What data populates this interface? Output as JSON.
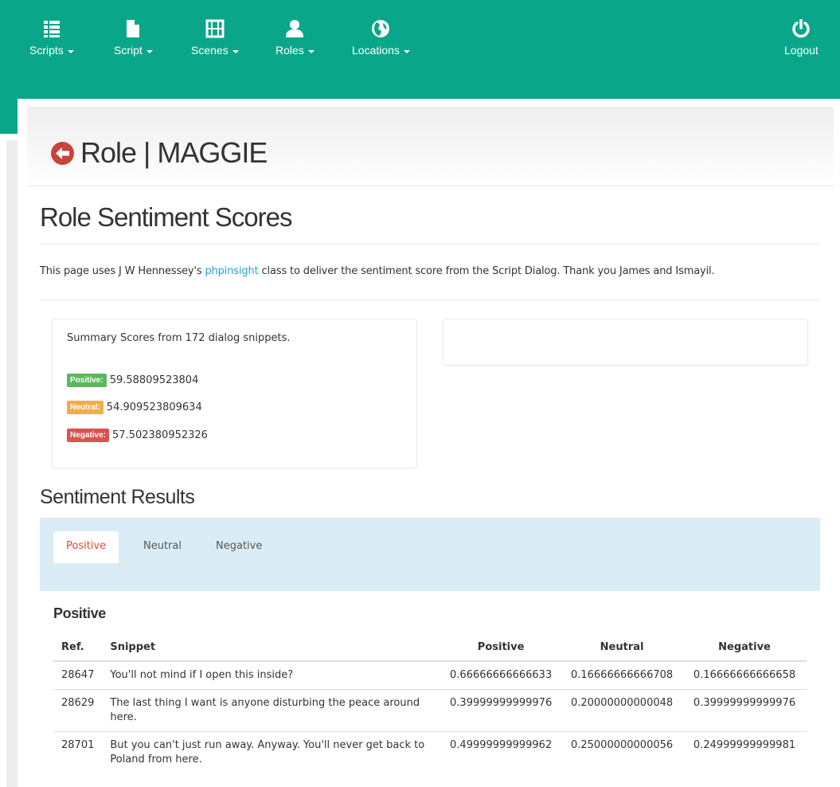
{
  "nav": {
    "items": [
      {
        "label": "Scripts",
        "icon": "list-icon"
      },
      {
        "label": "Script",
        "icon": "file-icon"
      },
      {
        "label": "Scenes",
        "icon": "film-icon"
      },
      {
        "label": "Roles",
        "icon": "user-icon"
      },
      {
        "label": "Locations",
        "icon": "globe-icon"
      }
    ],
    "logout": {
      "label": "Logout",
      "icon": "power-icon"
    }
  },
  "page": {
    "title": "Role | MAGGIE"
  },
  "sentiment": {
    "heading": "Role Sentiment Scores",
    "intro_before": "This page uses J W Hennessey's ",
    "intro_link": "phpinsight",
    "intro_after": " class to deliver the sentiment score from the Script Dialog. Thank you James and Ismayil."
  },
  "summary": {
    "text": "Summary Scores from 172 dialog snippets.",
    "positive_label": "Positive:",
    "positive_value": "59.58809523804",
    "neutral_label": "Neutral:",
    "neutral_value": "54.909523809634",
    "negative_label": "Negative:",
    "negative_value": "57.502380952326"
  },
  "results": {
    "heading": "Sentiment Results",
    "tabs": [
      "Positive",
      "Neutral",
      "Negative"
    ],
    "active_tab": "Positive",
    "section_title": "Positive",
    "columns": [
      "Ref.",
      "Snippet",
      "Positive",
      "Neutral",
      "Negative"
    ],
    "rows": [
      {
        "ref": "28647",
        "snippet": "You'll not mind if I open this inside?",
        "positive": "0.66666666666633",
        "neutral": "0.16666666666708",
        "negative": "0.16666666666658"
      },
      {
        "ref": "28629",
        "snippet": "The last thing I want is anyone disturbing the peace around here.",
        "positive": "0.39999999999976",
        "neutral": "0.20000000000048",
        "negative": "0.39999999999976"
      },
      {
        "ref": "28701",
        "snippet": "But you can't just run away. Anyway. You'll never get back to Poland from here.",
        "positive": "0.49999999999962",
        "neutral": "0.25000000000056",
        "negative": "0.24999999999981"
      }
    ]
  },
  "colors": {
    "nav_bg": "#0aa68a",
    "positive": "#5cb85c",
    "neutral": "#f0ad4e",
    "negative": "#d9534f",
    "tab_active": "#dd4b39",
    "tabs_bg": "#daedf7",
    "link": "#2a9fd6"
  }
}
